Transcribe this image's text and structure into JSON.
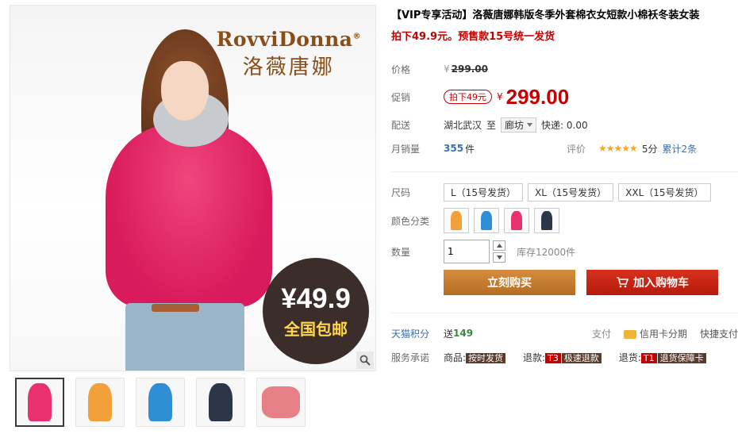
{
  "gallery": {
    "brand_en": "RovviDonna",
    "brand_mark": "®",
    "brand_cn": "洛薇唐娜",
    "badge_price": "¥49.9",
    "badge_text": "全国包邮",
    "thumbnails": [
      "pink",
      "orange",
      "blue",
      "navy",
      "detail"
    ],
    "colors": {
      "pink": "#e8316e",
      "orange": "#f2a03a",
      "blue": "#2f8fd4",
      "navy": "#2b3648",
      "detail": "#e67f86"
    }
  },
  "product": {
    "title": "【VIP专享活动】洛薇唐娜韩版冬季外套棉衣女短款小棉袄冬装女装",
    "subtitle": "拍下49.9元。预售款15号统一发货"
  },
  "price": {
    "label_price": "价格",
    "old_price": "299.00",
    "currency": "¥",
    "label_promo": "促销",
    "promo_tag": "拍下49元",
    "promo_price": "299.00",
    "label_ship": "配送",
    "ship_from": "湖北武汉",
    "ship_to_label": "至",
    "ship_to": "廊坊",
    "express": "快递: 0.00",
    "label_sales": "月销量",
    "sales_count": "355",
    "sales_unit": "件",
    "rating_label": "评价",
    "stars": "★★★★★",
    "score": "5分",
    "reviews": "累计2条"
  },
  "options": {
    "size_label": "尺码",
    "sizes": [
      "L（15号发货）",
      "XL（15号发货）",
      "XXL（15号发货）"
    ],
    "color_label": "颜色分类",
    "qty_label": "数量",
    "qty_value": "1",
    "stock": "库存12000件"
  },
  "actions": {
    "buy": "立刻购买",
    "cart": "加入购物车"
  },
  "service": {
    "points_label": "天猫积分",
    "points_text": "送",
    "points_value": "149",
    "pay_label": "支付",
    "credit": "信用卡分期",
    "quick_pay": "快捷支付",
    "promise_label": "服务承诺",
    "goods_label": "商品:",
    "goods_tag": "按时发货",
    "refund_label": "退款:",
    "refund_num": "T3",
    "refund_tag": "极速退款",
    "return_label": "退货:",
    "return_num": "T1",
    "return_tag": "退货保障卡"
  }
}
